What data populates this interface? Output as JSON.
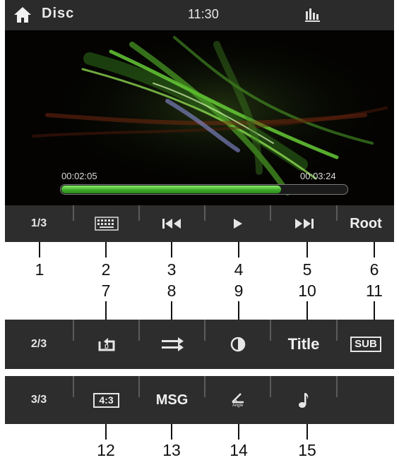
{
  "status_bar": {
    "home_icon": "home-icon",
    "source": "Disc",
    "time": "11:30",
    "eq_icon": "equalizer-icon"
  },
  "player": {
    "elapsed": "00:02:05",
    "total": "00:03:24",
    "progress_fraction": 0.77,
    "progress_color": "#3aa526"
  },
  "bar1": {
    "page": "1/3",
    "keyboard_icon": "keyboard-icon",
    "prev_icon": "previous-track-icon",
    "play_icon": "play-icon",
    "next_icon": "next-track-icon",
    "root": "Root"
  },
  "bar2": {
    "page": "2/3",
    "repeat_icon": "repeat-disc-icon",
    "shuffle_icon": "shuffle-icon",
    "brightness_icon": "brightness-icon",
    "title": "Title",
    "sub": "SUB"
  },
  "bar3": {
    "page": "3/3",
    "aspect": "4:3",
    "msg": "MSG",
    "angle_label": "Angle",
    "audio_icon": "music-note-icon"
  },
  "callouts": {
    "row1": [
      "1",
      "2",
      "3",
      "4",
      "5",
      "6"
    ],
    "row2": [
      "7",
      "8",
      "9",
      "10",
      "11"
    ],
    "row3": [
      "12",
      "13",
      "14",
      "15"
    ]
  }
}
